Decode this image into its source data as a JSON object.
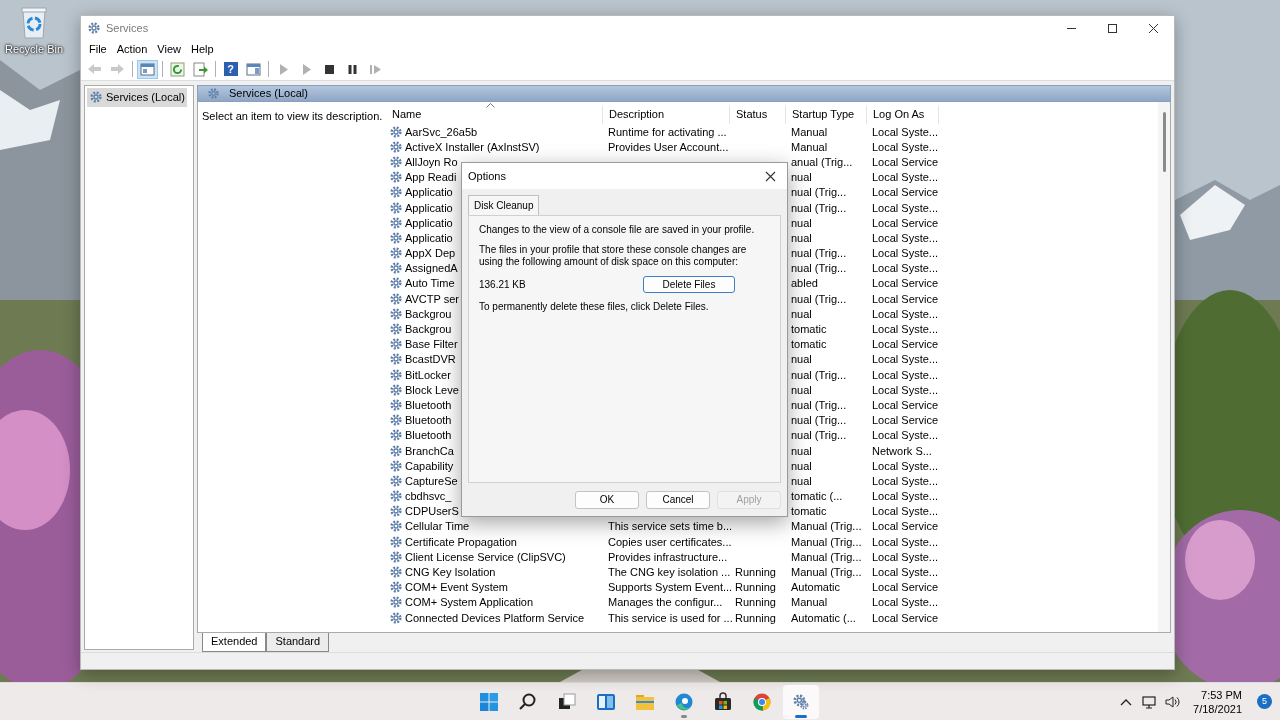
{
  "desktop": {
    "icons": [
      {
        "label": "Recycle Bin"
      }
    ]
  },
  "window": {
    "title": "Services",
    "controls": [
      {
        "kind": "minimize"
      },
      {
        "kind": "maximize"
      },
      {
        "kind": "close"
      }
    ]
  },
  "menu": [
    "File",
    "Action",
    "View",
    "Help"
  ],
  "toolbar": [
    [
      {
        "kind": "back",
        "disabled": true,
        "pressed": false
      },
      {
        "kind": "forward",
        "disabled": true,
        "pressed": false
      }
    ],
    [
      {
        "kind": "console-tree",
        "disabled": false,
        "pressed": true
      }
    ],
    [
      {
        "kind": "refresh",
        "disabled": false,
        "pressed": false
      },
      {
        "kind": "export",
        "disabled": false,
        "pressed": false
      }
    ],
    [
      {
        "kind": "help",
        "glyph": "?",
        "disabled": false,
        "pressed": false
      },
      {
        "kind": "action-pane",
        "disabled": false,
        "pressed": false
      }
    ],
    [
      {
        "kind": "start",
        "disabled": true,
        "pressed": false
      },
      {
        "kind": "start",
        "disabled": true,
        "pressed": false
      },
      {
        "kind": "stop",
        "disabled": false,
        "pressed": false
      },
      {
        "kind": "pause",
        "disabled": false,
        "pressed": false
      },
      {
        "kind": "restart",
        "disabled": true,
        "pressed": false
      }
    ]
  ],
  "tree": [
    {
      "label": "Services (Local)",
      "selected": true
    }
  ],
  "pane_header": "Services (Local)",
  "description_pane": "Select an item to view its description.",
  "table": {
    "columns": [
      {
        "label": "Name",
        "sorted": true
      },
      {
        "label": "Description",
        "sorted": false
      },
      {
        "label": "Status",
        "sorted": false
      },
      {
        "label": "Startup Type",
        "sorted": false
      },
      {
        "label": "Log On As",
        "sorted": false
      }
    ],
    "rows": [
      {
        "name": "AarSvc_26a5b",
        "description": "Runtime for activating ...",
        "startup": "Manual",
        "log_on": "Local Syste..."
      },
      {
        "name": "ActiveX Installer (AxInstSV)",
        "description": "Provides User Account...",
        "startup": "Manual",
        "log_on": "Local Syste..."
      },
      {
        "name": "AllJoyn Ro",
        "startup": "anual (Trig...",
        "log_on": "Local Service"
      },
      {
        "name": "App Readi",
        "startup": "nual",
        "log_on": "Local Syste..."
      },
      {
        "name": "Applicatio",
        "startup": "nual (Trig...",
        "log_on": "Local Service"
      },
      {
        "name": "Applicatio",
        "startup": "nual (Trig...",
        "log_on": "Local Syste..."
      },
      {
        "name": "Applicatio",
        "startup": "nual",
        "log_on": "Local Service"
      },
      {
        "name": "Applicatio",
        "startup": "nual",
        "log_on": "Local Syste..."
      },
      {
        "name": "AppX Dep",
        "startup": "nual (Trig...",
        "log_on": "Local Syste..."
      },
      {
        "name": "AssignedA",
        "startup": "nual (Trig...",
        "log_on": "Local Syste..."
      },
      {
        "name": "Auto Time",
        "startup": "abled",
        "log_on": "Local Service"
      },
      {
        "name": "AVCTP ser",
        "startup": "nual (Trig...",
        "log_on": "Local Service"
      },
      {
        "name": "Backgrou",
        "startup": "nual",
        "log_on": "Local Syste..."
      },
      {
        "name": "Backgrou",
        "startup": "tomatic",
        "log_on": "Local Syste..."
      },
      {
        "name": "Base Filter",
        "startup": "tomatic",
        "log_on": "Local Service"
      },
      {
        "name": "BcastDVR",
        "startup": "nual",
        "log_on": "Local Syste..."
      },
      {
        "name": "BitLocker",
        "startup": "nual (Trig...",
        "log_on": "Local Syste..."
      },
      {
        "name": "Block Leve",
        "startup": "nual",
        "log_on": "Local Syste..."
      },
      {
        "name": "Bluetooth",
        "startup": "nual (Trig...",
        "log_on": "Local Service"
      },
      {
        "name": "Bluetooth",
        "startup": "nual (Trig...",
        "log_on": "Local Service"
      },
      {
        "name": "Bluetooth",
        "startup": "nual (Trig...",
        "log_on": "Local Syste..."
      },
      {
        "name": "BranchCa",
        "startup": "nual",
        "log_on": "Network S..."
      },
      {
        "name": "Capability",
        "startup": "nual",
        "log_on": "Local Syste..."
      },
      {
        "name": "CaptureSe",
        "startup": "nual",
        "log_on": "Local Syste..."
      },
      {
        "name": "cbdhsvc_",
        "startup": "tomatic (...",
        "log_on": "Local Syste..."
      },
      {
        "name": "CDPUserS",
        "startup": "tomatic",
        "log_on": "Local Syste..."
      },
      {
        "name": "Cellular Time",
        "description": "This service sets time b...",
        "startup": "Manual (Trig...",
        "log_on": "Local Service"
      },
      {
        "name": "Certificate Propagation",
        "description": "Copies user certificates...",
        "startup": "Manual (Trig...",
        "log_on": "Local Syste..."
      },
      {
        "name": "Client License Service (ClipSVC)",
        "description": "Provides infrastructure...",
        "startup": "Manual (Trig...",
        "log_on": "Local Syste..."
      },
      {
        "name": "CNG Key Isolation",
        "description": "The CNG key isolation ...",
        "status": "Running",
        "startup": "Manual (Trig...",
        "log_on": "Local Syste..."
      },
      {
        "name": "COM+ Event System",
        "description": "Supports System Event...",
        "status": "Running",
        "startup": "Automatic",
        "log_on": "Local Service"
      },
      {
        "name": "COM+ System Application",
        "description": "Manages the configur...",
        "status": "Running",
        "startup": "Manual",
        "log_on": "Local Syste..."
      },
      {
        "name": "Connected Devices Platform Service",
        "description": "This service is used for ...",
        "status": "Running",
        "startup": "Automatic (...",
        "log_on": "Local Service"
      }
    ]
  },
  "view_tabs": [
    {
      "label": "Extended",
      "selected": true
    },
    {
      "label": "Standard",
      "selected": false
    }
  ],
  "dialog": {
    "title": "Options",
    "tabs": [
      {
        "label": "Disk Cleanup",
        "selected": true
      }
    ],
    "message": "Changes to the view of a console file are saved in your profile.",
    "usage_note": "The files in your profile that store these console changes are using the following amount of disk space on this computer:",
    "size": "136.21 KB",
    "delete_button": "Delete Files",
    "instruction": "To permanently delete these files, click Delete Files.",
    "buttons": [
      {
        "label": "OK",
        "disabled": false
      },
      {
        "label": "Cancel",
        "disabled": false
      },
      {
        "label": "Apply",
        "disabled": true
      }
    ]
  },
  "taskbar": {
    "apps": [
      {
        "kind": "start",
        "open": false,
        "selected": false
      },
      {
        "kind": "search",
        "open": false,
        "selected": false
      },
      {
        "kind": "task-view",
        "open": false,
        "selected": false
      },
      {
        "kind": "widgets",
        "open": false,
        "selected": false
      },
      {
        "kind": "folder",
        "open": false,
        "selected": false
      },
      {
        "kind": "edge",
        "open": true,
        "selected": false
      },
      {
        "kind": "store",
        "open": false,
        "selected": false
      },
      {
        "kind": "chrome",
        "open": false,
        "selected": false
      },
      {
        "kind": "services",
        "open": true,
        "selected": true
      }
    ],
    "tray": [
      {
        "kind": "chevron"
      },
      {
        "kind": "network"
      },
      {
        "kind": "volume"
      }
    ],
    "time": "7:53 PM",
    "date": "7/18/2021",
    "notifications": "5"
  }
}
